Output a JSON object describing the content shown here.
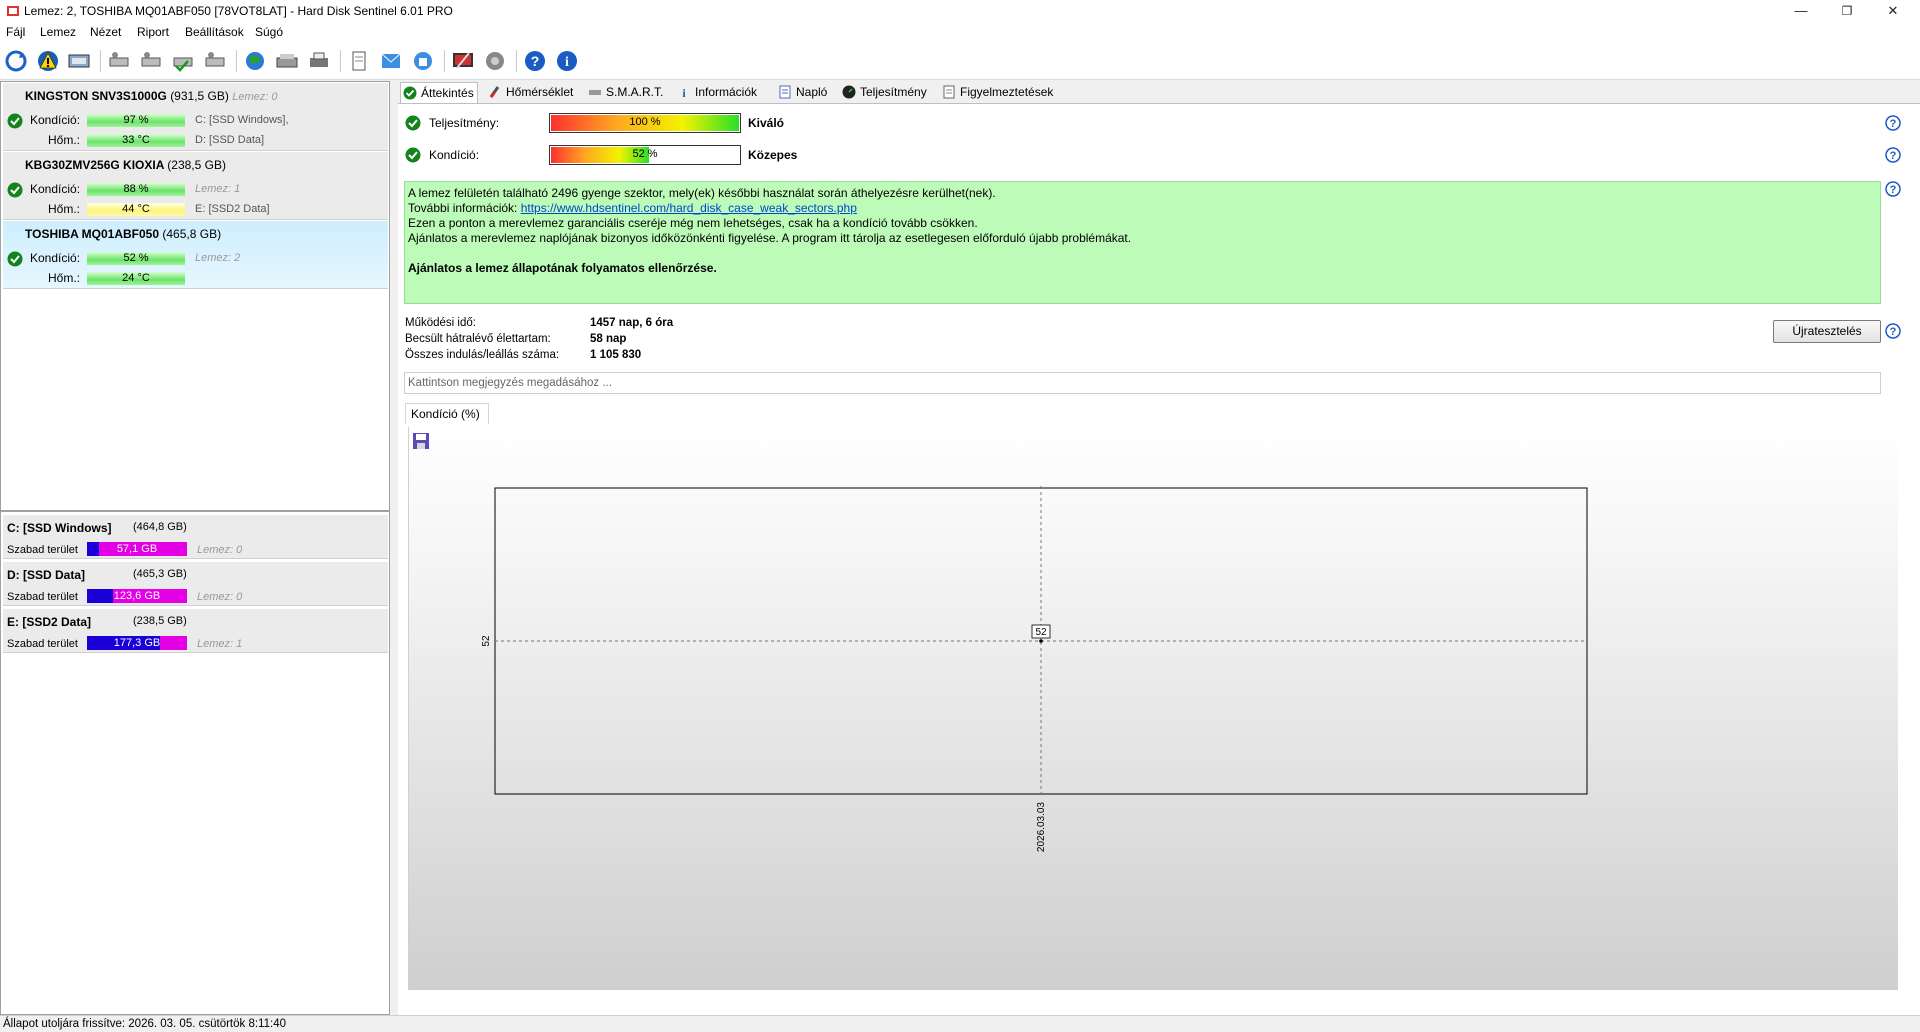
{
  "window": {
    "title": "Lemez: 2, TOSHIBA MQ01ABF050 [78VOT8LAT]  -  Hard Disk Sentinel 6.01 PRO",
    "minimize": "—",
    "maximize": "❐",
    "close": "✕"
  },
  "menu": [
    "Fájl",
    "Lemez",
    "Nézet",
    "Riport",
    "Beállítások",
    "Súgó"
  ],
  "disks": [
    {
      "name": "KINGSTON SNV3S1000G",
      "size": "(931,5 GB)",
      "disk_no": "Lemez: 0",
      "condition_label": "Kondíció:",
      "condition": "97 %",
      "temp_label": "Hőm.:",
      "temp": "33 °C",
      "vol1": "C: [SSD Windows],",
      "vol2": "D: [SSD Data]"
    },
    {
      "name": "KBG30ZMV256G KIOXIA",
      "size": "(238,5 GB)",
      "disk_no": "",
      "condition_label": "Kondíció:",
      "condition": "88 %",
      "temp_label": "Hőm.:",
      "temp": "44 °C",
      "vol1": "Lemez: 1",
      "vol2": "E: [SSD2 Data]"
    },
    {
      "name": "TOSHIBA MQ01ABF050",
      "size": "(465,8 GB)",
      "disk_no": "",
      "condition_label": "Kondíció:",
      "condition": "52 %",
      "temp_label": "Hőm.:",
      "temp": "24 °C",
      "vol1": "Lemez: 2",
      "vol2": ""
    }
  ],
  "volumes": [
    {
      "name": "C: [SSD Windows]",
      "size": "(464,8 GB)",
      "free_label": "Szabad terület",
      "free": "57,1 GB",
      "free_fraction": 0.12,
      "disk": "Lemez: 0"
    },
    {
      "name": "D: [SSD Data]",
      "size": "(465,3 GB)",
      "free_label": "Szabad terület",
      "free": "123,6 GB",
      "free_fraction": 0.27,
      "disk": "Lemez: 0"
    },
    {
      "name": "E: [SSD2 Data]",
      "size": "(238,5 GB)",
      "free_label": "Szabad terület",
      "free": "177,3 GB",
      "free_fraction": 0.74,
      "disk": "Lemez: 1"
    }
  ],
  "tabs": [
    "Áttekintés",
    "Hőmérséklet",
    "S.M.A.R.T.",
    "Információk",
    "Napló",
    "Teljesítmény",
    "Figyelmeztetések"
  ],
  "overview": {
    "performance_label": "Teljesítmény:",
    "performance_value": "100 %",
    "performance_fraction": 1.0,
    "performance_word": "Kiváló",
    "condition_label": "Kondíció:",
    "condition_value": "52 %",
    "condition_fraction": 0.52,
    "condition_word": "Közepes",
    "info_line1": "A lemez felületén található 2496 gyenge szektor, mely(ek) későbbi használat során áthelyezésre kerülhet(nek).",
    "info_line2_prefix": "További információk: ",
    "info_link": "https://www.hdsentinel.com/hard_disk_case_weak_sectors.php",
    "info_line3": "Ezen a ponton a merevlemez garanciális cseréje még nem lehetséges, csak ha a kondíció tovább csökken.",
    "info_line4": "Ajánlatos a merevlemez naplójának bizonyos időközönkénti figyelése. A program itt tárolja az esetlegesen előforduló újabb problémákat.",
    "info_bold": "Ajánlatos a lemez állapotának folyamatos ellenőrzése.",
    "uptime_label": "Működési idő:",
    "uptime": "1457 nap, 6 óra",
    "lifetime_label": "Becsült hátralévő élettartam:",
    "lifetime": "58 nap",
    "startstop_label": "Összes indulás/leállás száma:",
    "startstop": "1 105 830",
    "retest_button": "Újratesztelés",
    "note_placeholder": "Kattintson megjegyzés megadásához ..."
  },
  "chart_tab": "Kondíció  (%)",
  "chart_data": {
    "type": "line",
    "title": "",
    "xlabel": "",
    "ylabel": "",
    "x": [
      "2026.03.03"
    ],
    "series": [
      {
        "values": [
          52
        ]
      }
    ],
    "y_tick": "52",
    "x_tick": "2026.03.03",
    "point_label": "52"
  },
  "status": "Állapot utoljára frissítve: 2026. 03. 05. csütörtök 8:11:40"
}
